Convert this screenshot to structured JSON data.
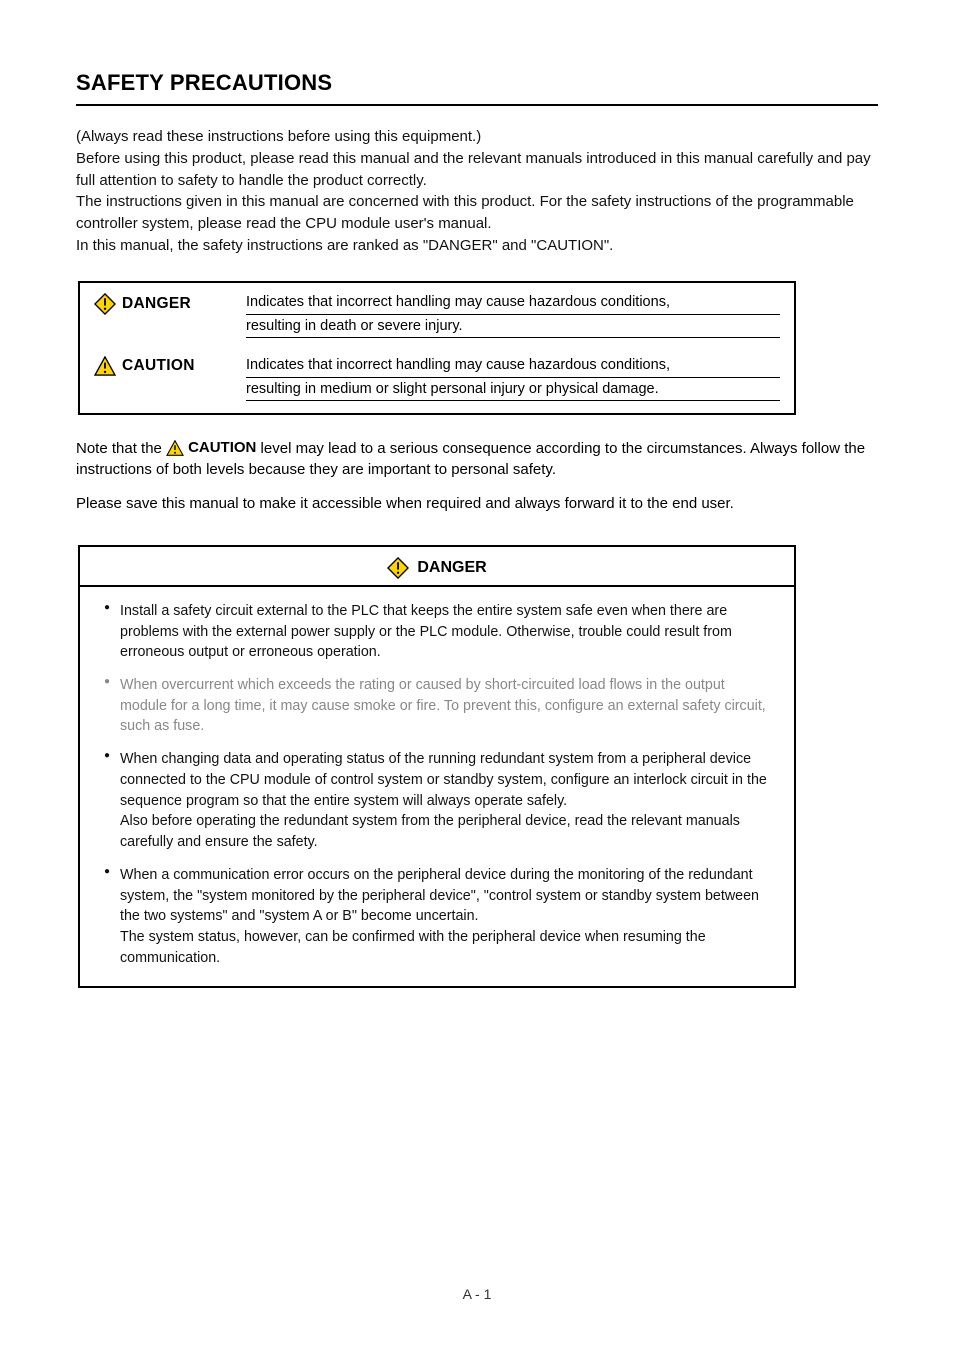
{
  "title": "SAFETY PRECAUTIONS",
  "intro": "(Always read these instructions before using this equipment.)\nBefore using this product, please read this manual and the relevant manuals introduced in this manual carefully and pay full attention to safety to handle the product correctly.\nThe instructions given in this manual are concerned with this product. For the safety instructions of the programmable controller system, please read the CPU module user's manual.\nIn this manual, the safety instructions are ranked as \"DANGER\" and \"CAUTION\".",
  "legend": {
    "danger": {
      "label": "DANGER",
      "text_line1": "Indicates that incorrect handling may cause hazardous conditions,",
      "text_line2": "resulting in death or severe injury."
    },
    "caution": {
      "label": "CAUTION",
      "text_line1": "Indicates that incorrect handling may cause hazardous conditions,",
      "text_line2": "resulting in medium or slight personal injury or physical damage."
    }
  },
  "after_legend_prefix": "Note that the ",
  "after_legend_caution_label": "CAUTION",
  "after_legend_suffix": " level may lead to a serious consequence according to the circumstances. Always follow the instructions of both levels because they are important to personal safety.",
  "save_paragraph": "Please save this manual to make it accessible when required and always forward it to the end user.",
  "danger_block": {
    "header": "DANGER",
    "items": [
      {
        "text": "Install a safety circuit external to the PLC that keeps the entire system safe even when there are problems with the external power supply or the PLC module. Otherwise, trouble could result from erroneous output or erroneous operation.",
        "grey": false
      },
      {
        "text": "When overcurrent which exceeds the rating or caused by short-circuited load flows in the output module for a long time, it may cause smoke or fire. To prevent this, configure an external safety circuit, such as fuse.",
        "grey": true
      },
      {
        "text": "When changing data and operating status of the running redundant system from a peripheral device connected to the CPU module of control system or standby system, configure an interlock circuit in the sequence program so that the entire system will always operate safely.\nAlso before operating the redundant system from the peripheral device, read the relevant manuals carefully and ensure the safety.",
        "grey": false
      },
      {
        "text": "When a communication error occurs on the peripheral device during the monitoring of the redundant system, the \"system monitored by the peripheral device\", \"control system or standby system between the two systems\" and \"system A or B\" become uncertain.\nThe system status, however, can be confirmed with the peripheral device when resuming the communication.",
        "grey": false
      }
    ]
  },
  "page_number": "A - 1"
}
